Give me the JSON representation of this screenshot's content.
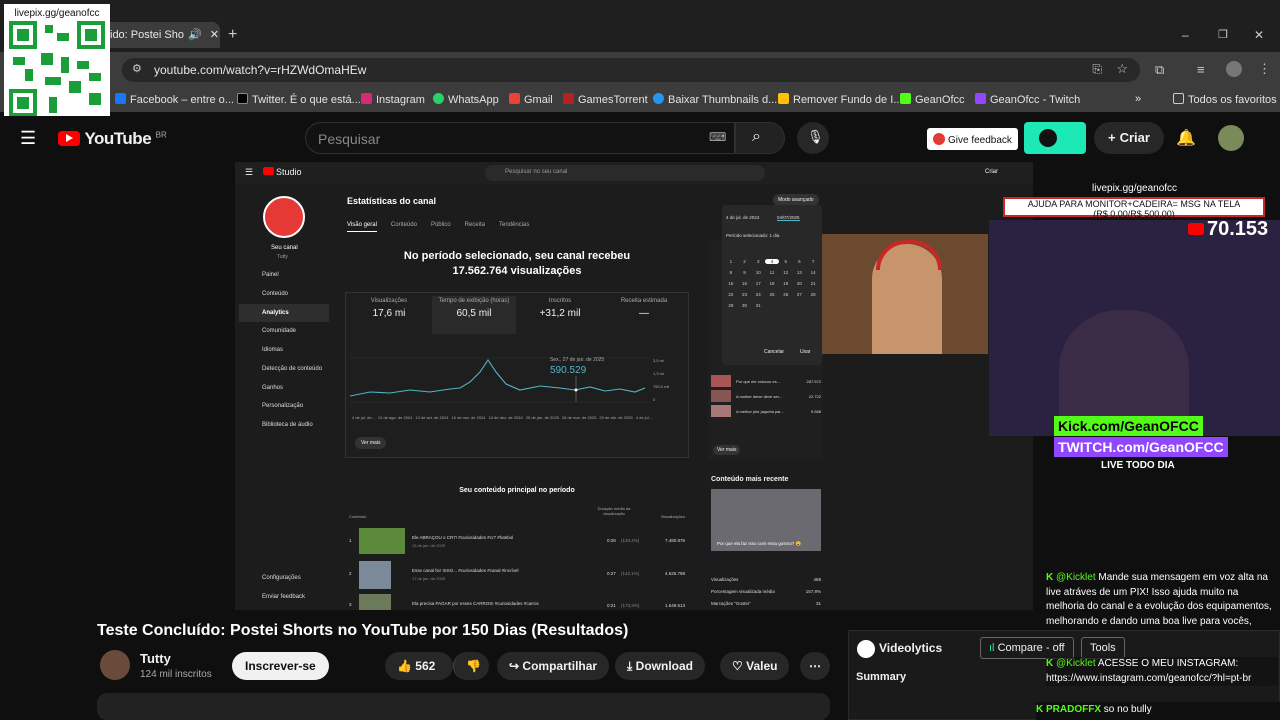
{
  "browser": {
    "tab_title": "ido: Postei Sho",
    "new_tab": "+",
    "url": "youtube.com/watch?v=rHZWdOmaHEw",
    "window_controls": [
      "–",
      "❐",
      "✕"
    ],
    "bookmarks": [
      {
        "label": "Facebook – entre o...",
        "color": "#1877f2"
      },
      {
        "label": "Twitter. É o que está...",
        "color": "#000000"
      },
      {
        "label": "Instagram",
        "color": "#d62976"
      },
      {
        "label": "WhatsApp",
        "color": "#25d366"
      },
      {
        "label": "Gmail",
        "color": "#ea4335"
      },
      {
        "label": "GamesTorrent",
        "color": "#b22222"
      },
      {
        "label": "Baixar Thumbnails d...",
        "color": "#2196f3"
      },
      {
        "label": "Remover Fundo de I...",
        "color": "#ffc107"
      },
      {
        "label": "GeanOfcc",
        "color": "#53fc18"
      },
      {
        "label": "GeanOfcc - Twitch",
        "color": "#9146ff"
      }
    ],
    "all_favorites": "Todos os favoritos"
  },
  "overlay": {
    "qr_label": "livepix.gg/geanofcc"
  },
  "youtube": {
    "logo": "YouTube",
    "region": "BR",
    "search_placeholder": "Pesquisar",
    "feedback": "Give feedback",
    "create": "Criar"
  },
  "studio": {
    "logo": "Studio",
    "search_placeholder": "Pesquisar no seu canal",
    "create": "Criar",
    "channel_name": "Tutty",
    "your_channel": "Seu canal",
    "nav": [
      "Painel",
      "Conteúdo",
      "Analytics",
      "Comunidade",
      "Idiomas",
      "Detecção de conteúdo",
      "Ganhos",
      "Personalização",
      "Biblioteca de áudio"
    ],
    "nav_bottom": [
      "Configurações",
      "Enviar feedback"
    ],
    "page_title": "Estatísticas do canal",
    "advanced": "Modo avançado",
    "tabs": [
      "Visão geral",
      "Conteúdo",
      "Público",
      "Receita",
      "Tendências"
    ],
    "headline_1": "No período selecionado, seu canal recebeu",
    "headline_2": "17.562.764 visualizações",
    "metrics": [
      {
        "label": "Visualizações",
        "value": "17,6 mi"
      },
      {
        "label": "Tempo de exibição (horas)",
        "value": "60,5 mil"
      },
      {
        "label": "Inscritos",
        "value": "+31,2 mil"
      },
      {
        "label": "Receita estimada",
        "value": "—"
      }
    ],
    "tooltip_date": "Sex., 27 de jan. de 2025",
    "tooltip_value": "590.529",
    "y_ticks": [
      "3,5 mi",
      "1,3 mi",
      "750,0 mil",
      "0"
    ],
    "x_ticks": [
      "4 de jul. de...",
      "13 de ago. de 2024",
      "13 de set. de 2024",
      "10 de nov. de 2024",
      "15 de dez. de 2024",
      "25 de jan. de 2025",
      "28 de mar. de 2025",
      "29 de abr. de 2025",
      "4 de jul..."
    ],
    "see_more": "Ver mais",
    "top_content_title": "Seu conteúdo principal no período",
    "table_headers": [
      "Conteúdo",
      "Duração média da visualização",
      "Visualizações"
    ],
    "rows": [
      {
        "n": "1",
        "title": "Ele ABRAÇOU o CR7! #curiosidades #cr7 #futebol",
        "date": "13 de jan. de 2025",
        "dur": "0:28",
        "pct": "(140,4%)",
        "views": "7.480.876"
      },
      {
        "n": "2",
        "title": "Esse canal fez ISSO... #curiosidades #canal #incrível",
        "date": "17 de jan. de 2025",
        "dur": "0:27",
        "pct": "(142,1%)",
        "views": "4.625.798"
      },
      {
        "n": "3",
        "title": "Ela precisa PAGAR por esses CARROS! #curiosidades #carros",
        "date": "",
        "dur": "0:21",
        "pct": "(173,3%)",
        "views": "1.649.513"
      }
    ],
    "date_from": "4 de jul. de 2024",
    "date_to": "04/07/2025",
    "period_selected": "Período selecionado: 1 dia",
    "calendar_days": [
      "1",
      "2",
      "3",
      "4",
      "5",
      "6",
      "7",
      "8",
      "9",
      "10",
      "11",
      "12",
      "13",
      "14",
      "15",
      "16",
      "17",
      "18",
      "19",
      "20",
      "21",
      "22",
      "23",
      "24",
      "25",
      "26",
      "27",
      "28",
      "29",
      "30",
      "31"
    ],
    "cancel": "Cancelar",
    "apply": "Usar",
    "right_panel_items": [
      {
        "title": "Por que ele colocou es...",
        "views": "287.572"
      },
      {
        "title": "A mulher deixe deve ser...",
        "views": "22.722"
      },
      {
        "title": "A melhor pior jaqueta par...",
        "views": "9.688"
      }
    ],
    "right_see_more": "Ver mais",
    "recent_title": "Conteúdo mais recente",
    "recent_caption": "Por que ela faz isso com essa gosma? 😮",
    "recent_stats": [
      {
        "label": "Visualizações",
        "value": "468"
      },
      {
        "label": "Porcentagem visualizada média",
        "value": "157,8%"
      },
      {
        "label": "Marcações \"Gostei\"",
        "value": "31"
      }
    ]
  },
  "stream": {
    "livepix": "livepix.gg/geanofcc",
    "goal": "AJUDA PARA MONITOR+CADEIRA= MSG NA TELA",
    "goal_progress": "(R$ 0,00/R$ 500,00)",
    "viewer_count": "70.153",
    "kick": "Kick.com/GeanOFCC",
    "twitch": "TWITCH.com/GeanOFCC",
    "live_daily": "LIVE TODO DIA"
  },
  "chat": [
    {
      "user": "@Kicklet",
      "msg": "Mande sua mensagem em voz alta na live atráves de um PIX! Isso ajuda muito na melhoria do canal e a evolução dos equipamentos, melhorando e dando uma boa live para vocês, MUITO OBRIGADO! https://livepix.gg/geanofcc"
    },
    {
      "user": "@Kicklet",
      "msg": "ACESSE O MEU INSTAGRAM: https://www.instagram.com/geanofcc/?hl=pt-br"
    },
    {
      "user": "PRADOFFX",
      "msg": "so no bully"
    }
  ],
  "video": {
    "title": "Teste Concluído: Postei Shorts no YouTube por 150 Dias (Resultados)",
    "channel": "Tutty",
    "subs": "124 mil inscritos",
    "subscribe": "Inscrever-se",
    "likes": "562",
    "share": "Compartilhar",
    "download": "Download",
    "thanks": "Valeu"
  },
  "videolytics": {
    "title": "Videolytics",
    "compare": "Compare - off",
    "tools": "Tools",
    "summary": "Summary"
  }
}
